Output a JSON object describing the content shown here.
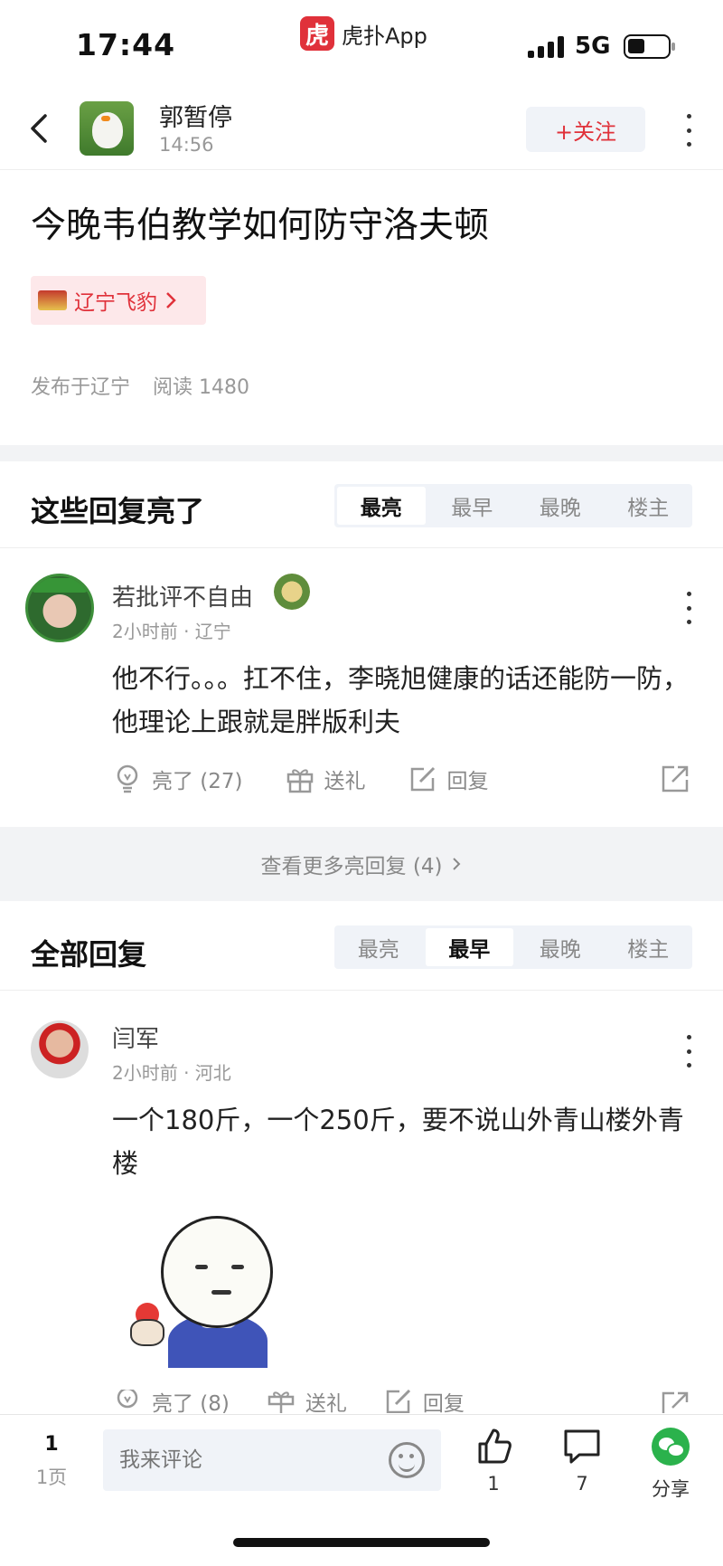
{
  "status_bar": {
    "time": "17:44",
    "app_name": "虎扑App",
    "app_logo_char": "虎",
    "network": "5G"
  },
  "header": {
    "author_name": "郭暂停",
    "post_time": "14:56",
    "follow_label": "+关注"
  },
  "post": {
    "title": "今晚韦伯教学如何防守洛夫顿",
    "tag": "辽宁飞豹",
    "location": "发布于辽宁",
    "reads": "阅读 1480"
  },
  "highlight_section": {
    "title": "这些回复亮了",
    "tabs": [
      "最亮",
      "最早",
      "最晚",
      "楼主"
    ],
    "active_tab": "最亮"
  },
  "highlight_comments": [
    {
      "user": "若批评不自由",
      "meta": "2小时前 · 辽宁",
      "body": "他不行。。。扛不住，李晓旭健康的话还能防一防，他理论上跟就是胖版利夫",
      "like_label": "亮了 (27)",
      "gift_label": "送礼",
      "reply_label": "回复"
    }
  ],
  "more_replies_label": "查看更多亮回复 (4)",
  "all_section": {
    "title": "全部回复",
    "tabs": [
      "最亮",
      "最早",
      "最晚",
      "楼主"
    ],
    "active_tab": "最早"
  },
  "all_comments": [
    {
      "user": "闫军",
      "meta": "2小时前 · 河北",
      "body": "一个180斤，一个250斤，要不说山外青山楼外青楼",
      "like_label": "亮了 (8)",
      "gift_label": "送礼",
      "reply_label": "回复"
    }
  ],
  "bottom_bar": {
    "page_num": "1",
    "page_label": "1页",
    "comment_placeholder": "我来评论",
    "like_count": "1",
    "comment_count": "7",
    "share_label": "分享"
  },
  "colors": {
    "brand_red": "#e0313a",
    "wechat_green": "#2bb24c",
    "band_gray": "#f2f3f5"
  },
  "icons": [
    "back-arrow-icon",
    "more-vertical-icon",
    "chevron-right-icon",
    "lightbulb-icon",
    "gift-icon",
    "edit-reply-icon",
    "share-external-icon",
    "thumbs-up-icon",
    "comment-bubble-icon",
    "wechat-icon",
    "emoji-icon"
  ]
}
